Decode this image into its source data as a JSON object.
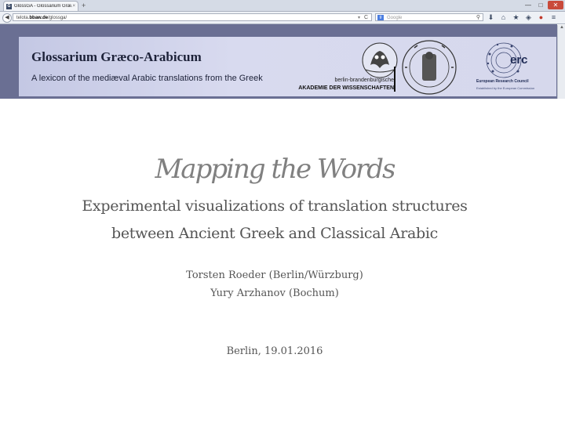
{
  "browser": {
    "tab_title": "GlossGA - Glossarium Græ...",
    "tab_close": "×",
    "new_tab": "+",
    "url_prefix": "telota.",
    "url_domain": "bbaw.de",
    "url_path": "/glossga/",
    "search_placeholder": "Google",
    "back_glyph": "◀",
    "reload_glyph": "C",
    "dropdown_glyph": "▾",
    "search_glyph": "⚲",
    "window_min": "—",
    "window_max": "□",
    "window_close": "✕",
    "toolbar_icons": [
      "download-icon",
      "home-icon",
      "bookmark-star-icon",
      "shield-icon",
      "addon-icon",
      "menu-icon"
    ]
  },
  "banner": {
    "title": "Glossarium Græco-Arabicum",
    "subtitle": "A lexicon of the mediæval Arabic translations from the Greek",
    "bbaw_line1": "berlin-brandenburgische",
    "bbaw_line2": "AKADEMIE DER WISSENSCHAFTEN",
    "erc_logo_text": "erc",
    "erc_name": "European Research Council",
    "erc_sub": "Established by the European Commission",
    "seal_text": "BOCHVM·RVHR·VNIVERSITAET",
    "background_color": "#6a6f93"
  },
  "slide": {
    "title": "Mapping the Words",
    "subtitle_line1": "Experimental visualizations of translation structures",
    "subtitle_line2": "between Ancient Greek and Classical Arabic",
    "author1": "Torsten Roeder (Berlin/Würzburg)",
    "author2": "Yury Arzhanov (Bochum)",
    "place_date": "Berlin, 19.01.2016"
  }
}
